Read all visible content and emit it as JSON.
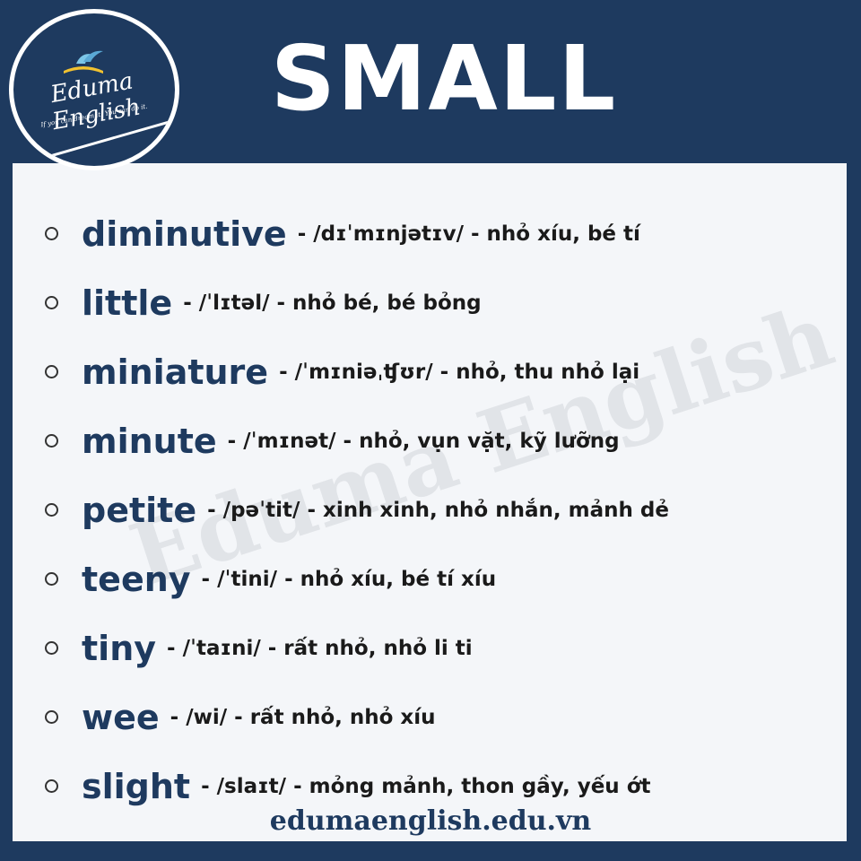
{
  "title": "SMALL",
  "logo": {
    "name": "Eduma English",
    "slogan": "If you can dream it! You can do it."
  },
  "watermark": "Eduma English",
  "items": [
    {
      "word": "diminutive",
      "definition": "- /dɪˈmɪnjətɪv/ - nhỏ xíu, bé tí"
    },
    {
      "word": "little",
      "definition": "- /ˈlɪtəl/ - nhỏ bé, bé bỏng"
    },
    {
      "word": "miniature",
      "definition": "- /ˈmɪniəˌʧʊr/ - nhỏ, thu nhỏ lại"
    },
    {
      "word": "minute",
      "definition": "- /ˈmɪnət/ - nhỏ, vụn vặt, kỹ lưỡng"
    },
    {
      "word": "petite",
      "definition": "- /pəˈtit/ - xinh xinh, nhỏ nhắn, mảnh dẻ"
    },
    {
      "word": "teeny",
      "definition": "- /ˈtini/ - nhỏ xíu, bé tí xíu"
    },
    {
      "word": "tiny",
      "definition": "- /ˈtaɪni/ - rất nhỏ, nhỏ li ti"
    },
    {
      "word": "wee",
      "definition": "- /wi/ - rất nhỏ, nhỏ xíu"
    },
    {
      "word": "slight",
      "definition": "- /slaɪt/ - mỏng mảnh, thon gầy, yếu ớt"
    }
  ],
  "footer": "edumaenglish.edu.vn",
  "colors": {
    "navy": "#1e3a5f",
    "card": "#f4f6f9",
    "text": "#1a1a1a"
  }
}
